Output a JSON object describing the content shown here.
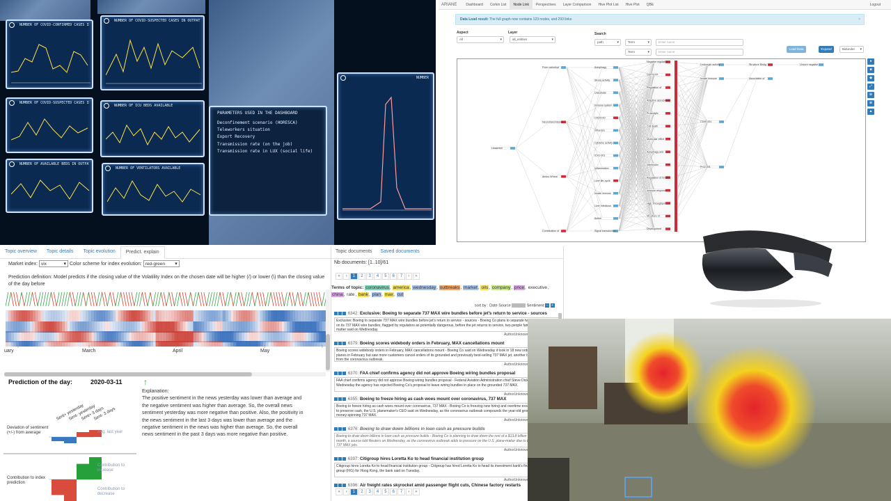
{
  "wall": {
    "screens": [
      {
        "title": "NUMBER OF COVID-CONFIRMED CASES IN EU"
      },
      {
        "title": "NUMBER OF COVID-SUSPECTED CASES IN OUTPATIENT"
      },
      {
        "title": "NUMBER OF COVID-SUSPECTED CASES IN EU"
      },
      {
        "title": "NUMBER OF ICU BEDS AVAILABLE"
      },
      {
        "title": "NUMBER OF AVAILABLE BEDS IN OUTPATIENT"
      },
      {
        "title": "NUMBER OF VENTILATORS AVAILABLE"
      },
      {
        "title": "NUMBER"
      }
    ],
    "params": {
      "title": "PARAMETERS USED IN THE DASHBOARD",
      "lines": [
        "Deconfinement scenario (HORESCA)",
        "Teleworkers situation",
        "Export Recovery",
        "Transmission rate (on the job)",
        "Transmission rate in LUX (social life)"
      ]
    }
  },
  "ariane": {
    "brand": "ARIANE",
    "nav": [
      "Dashboard",
      "Corkin List",
      "Node Link",
      "Perspectives",
      "Layer Comparison",
      "Hive Plot List",
      "Hive Plot",
      "QBE"
    ],
    "active_nav": "Node Link",
    "logout": "Logout",
    "alert": {
      "strong": "Data Load result:",
      "text": " The full graph now contains 123 nodes, and 293 links",
      "close": "×"
    },
    "aspect": {
      "label": "Aspect",
      "value": "All"
    },
    "layer": {
      "label": "Layer",
      "value": "all_entities"
    },
    "search": {
      "label": "Search",
      "path": "path",
      "term1": "Term",
      "term2": "Term",
      "ph1": "Enter name",
      "ph2": "Enter name"
    },
    "buttons": {
      "load": "Load Data",
      "expand": "Expand",
      "mode": "Bidunder"
    },
    "tools": [
      "●",
      "■",
      "◆",
      "⤢",
      "⊕",
      "⊗",
      "▲"
    ],
    "nodes": {
      "root": "Lissamine",
      "col1": [
        "From carbohyd",
        "Neurotransmission",
        "Amino Wheat",
        "Combination of"
      ],
      "col2": [
        "Autophagy",
        "Stress activity",
        "Unicellular",
        "Immune system",
        "CD25-HO",
        "Influenza",
        "Cytokine activity",
        "ICH1-001",
        "Inflammation",
        "Liver life-cycle",
        "Innate immune",
        "Liver infectious",
        "Action",
        "Signal transduction"
      ],
      "col3": [
        "Negative regulation",
        "GDP/GTP",
        "Regulation of",
        "Adaptive associated",
        "Proteolytic",
        "Cell death",
        "Molecular effect",
        "Autophagy and",
        "Interleukin",
        "Regulation of innate",
        "Immune response",
        "High Throughput",
        "Structure of",
        "Development"
      ],
      "col4": [
        "Leukocyte activity",
        "Innate Immune",
        "CD40-001",
        "Pro2-001"
      ],
      "col5": [
        "Structure Bindg",
        "Association of"
      ],
      "col6": [
        "Uncure negative"
      ]
    }
  },
  "topics": {
    "tabs": [
      "Topic overview",
      "Topic details",
      "Topic evolution",
      "Predict. explain"
    ],
    "active_tab": "Predict. explain",
    "market_label": "Market index:",
    "market_value": "vix",
    "scheme_label": "Color scheme for index evolution:",
    "scheme_value": "red-green",
    "definition": "Prediction definition: Model predicts if the closing value of the Volatility Index on the chosen date will be higher (/) or lower (\\) than the closing value of the day before",
    "months": [
      "uary",
      "March",
      "April",
      "May"
    ],
    "pred_title": "Prediction of the day:",
    "pred_date": "2020-03-11",
    "pred_arrow": "↑",
    "expl_label": "Explanation:",
    "explanation": "The positive sentiment in the news yesterday was lower than average and the negative sentiment was higher than average. So, the overall news sentiment yesterday was more negative than positive. Also, the positivity in the news sentiment in the last 3 days was lower than average and the negative sentiment in the news was higher than average. So, the overall news sentiment in the past 3 days was more negative than positive.",
    "col_labels": [
      "Sent+ yesterday",
      "Sent- yesterday",
      "Sent+ 3 days",
      "Sent- 3 days"
    ],
    "dev_label": "Deviation of sentiment (+/-) from average",
    "avg_label": "Avg. last year",
    "contrib_label": "Contribution to index prediction",
    "increase_label": "Contribution to increase",
    "decrease_label": "Contribution to decrease",
    "deviation": [
      -0.6,
      -0.9,
      0.7,
      1.0
    ],
    "contribution": [
      -1.0,
      -1.0,
      1.0,
      1.0
    ],
    "colors": {
      "red": "#d94b3d",
      "blue": "#3b78c2",
      "green": "#26a03a",
      "zigzag_up": "#3aa54a",
      "zigzag_down": "#d9412e"
    }
  },
  "docs": {
    "tabs": [
      "Topic documents",
      "Saved documents"
    ],
    "active_tab": "Topic documents",
    "nb_label": "Nb documents: [1..10]/61",
    "pages": [
      "«",
      "‹",
      "1",
      "2",
      "3",
      "4",
      "5",
      "6",
      "7",
      "›",
      "»"
    ],
    "terms_label": "Terms of topic:",
    "terms": [
      "coronavirus",
      "america",
      "wednesday",
      "outbreaks",
      "market",
      "oils",
      "company",
      "price",
      "executive",
      "china",
      "rate",
      "bank",
      "plan",
      "max",
      "cut"
    ],
    "sort_label": "sort by : Date Source",
    "sentiment_label": "Sentiment",
    "footer": "AuthorUnknown, In PublicationUnkn",
    "items": [
      {
        "num": "6342:",
        "title": "Exclusive: Boeing to separate 737 MAX wire bundles before jet's return to service - sources",
        "body": "Exclusive: Boeing to separate 737 MAX wire bundles before jet's return to service - sources - Boeing Co plans to separate two bundles of wiring on its 737 MAX wire bundles, flagged by regulators as potentially dangerous, before the jet returns to service, two people familiar with the matter said on Wednesday."
      },
      {
        "num": "6379:",
        "title": "Boeing scores widebody orders in February, MAX cancellations mount",
        "body": "Boeing scores widebody orders in February, MAX cancellations mount - Boeing Co said on Wednesday it took in 18 new orders for widebody planes in February but saw more customers cancel orders of its grounded and previously best-selling 737 MAX jet, another blow to demand from the coronavirus outbreak."
      },
      {
        "num": "6370:",
        "title": "FAA chief confirms agency did not approve Boeing wiring bundles proposal",
        "body": "FAA chief confirms agency did not approve Boeing wiring bundles proposal - Federal Aviation Administration chief Steve Dickson confirmed Wednesday the agency has rejected Boeing Co's proposal to leave wiring bundles in place on the grounded 737 MAX."
      },
      {
        "num": "6355:",
        "title": "Boeing to freeze hiring as cash woes mount over coronavirus, 737 MAX",
        "body": "Boeing to freeze hiring as cash woes mount over coronavirus, 737 MAX - Boeing Co is freezing new hiring and overtime except in critical areas to preserve cash, the U.S. planemaker's CEO said on Wednesday, as the coronavirus outbreak compounds the year-old grounding of its money-spinning 737 MAX."
      },
      {
        "num": "6376:",
        "title": "Boeing to draw down billions in loan cash as pressure builds",
        "body": "Boeing to draw down billions in loan cash as pressure builds - Boeing Co is planning to draw down the rest of a $13.8 billion loan taken out last month, a source told Reuters on Wednesday, as the coronavirus outbreak adds to pressure on the U.S. plane-maker due to the grounding of its 737 MAX jets."
      },
      {
        "num": "6397:",
        "title": "Citigroup hires Loretta Ko to head financial institution group",
        "body": "Citigroup hires Loretta Ko to head financial institution group - Citigroup has hired Loretta Ko to head its investment bank's financial institutions group (FIG) for Hong Kong, the bank said on Tuesday."
      },
      {
        "num": "6396:",
        "title": "Air freight rates skyrocket amid passenger flight cuts, Chinese factory restarts",
        "body": ""
      }
    ]
  }
}
